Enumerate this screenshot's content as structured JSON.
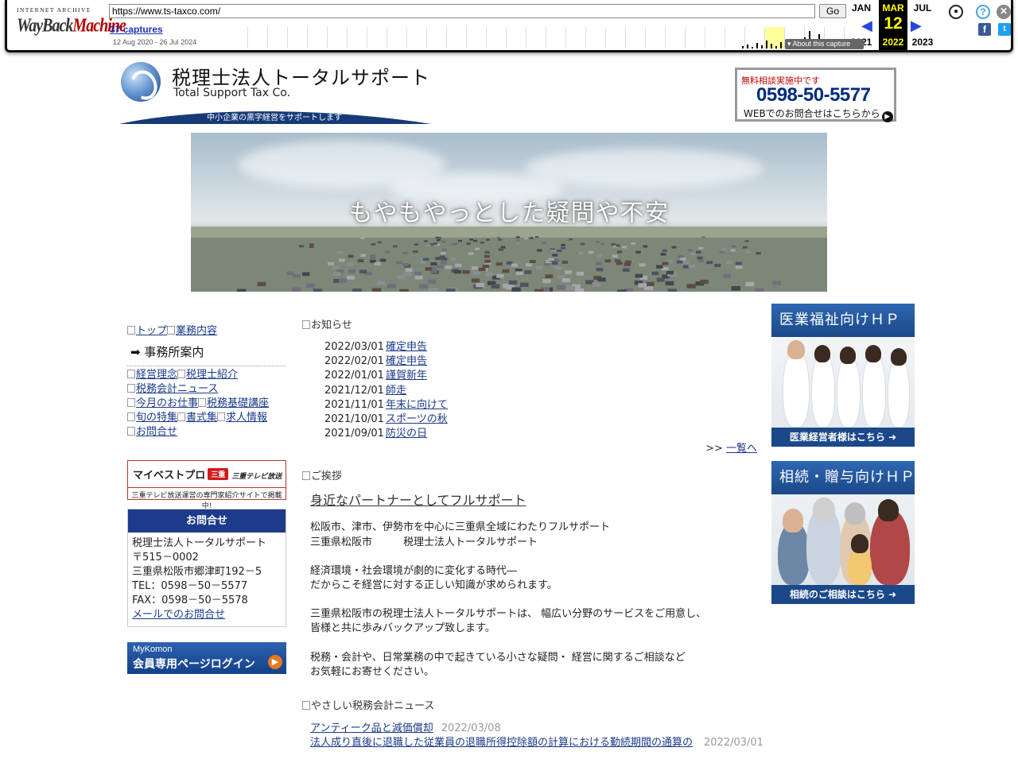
{
  "wayback": {
    "logo_top": "INTERNET ARCHIVE",
    "logo_main_a": "WayBack",
    "logo_main_b": "Machine",
    "url": "https://www.ts-taxco.com/",
    "go_label": "Go",
    "captures": "37 captures",
    "range": "12 Aug 2020 - 26 Jul 2024",
    "months": [
      {
        "month": "JAN",
        "year": "2021"
      },
      {
        "month": "MAR",
        "day": "12",
        "year": "2022"
      },
      {
        "month": "JUL",
        "year": "2023"
      }
    ],
    "about": "About this capture",
    "icons": [
      "user-icon",
      "help-icon",
      "close-icon",
      "facebook-icon",
      "twitter-icon"
    ]
  },
  "header": {
    "name": "税理士法人トータルサポート",
    "name_en": "Total Support Tax Co.",
    "tagline": "中小企業の黒字経営をサポートします",
    "contact_note": "無料相談実施中です",
    "phone": "0598-50-5577",
    "web_contact": "WEBでのお問合せはこちらから"
  },
  "hero": {
    "copy": "もやもやっとした疑問や不安"
  },
  "nav": {
    "row1": [
      "トップ",
      "業務内容"
    ],
    "current": "事務所案内",
    "row2": [
      "経営理念",
      "税理士紹介"
    ],
    "row3": [
      "税務会計ニュース"
    ],
    "row4": [
      "今月のお仕事",
      "税務基礎講座"
    ],
    "row5": [
      "旬の特集",
      "書式集",
      "求人情報"
    ],
    "row6": [
      "お問合せ"
    ]
  },
  "banner_mp": {
    "title": "マイベストプロ",
    "badge": "三重",
    "tv": "三重テレビ放送",
    "caption": "三重テレビ放送運営の専門家紹介サイトで掲載中!"
  },
  "contact": {
    "heading": "お問合せ",
    "lines": [
      "税理士法人トータルサポート",
      "〒515－0002",
      "三重県松阪市郷津町192－5",
      "TEL：0598－50－5577",
      "FAX：0598－50－5578"
    ],
    "mail_link": "メールでのお問合せ"
  },
  "mykomon": {
    "small": "MyKomon",
    "big": "会員専用ページログイン"
  },
  "news": {
    "heading": "お知らせ",
    "items": [
      {
        "date": "2022/03/01",
        "title": "確定申告"
      },
      {
        "date": "2022/02/01",
        "title": "確定申告"
      },
      {
        "date": "2022/01/01",
        "title": "謹賀新年"
      },
      {
        "date": "2021/12/01",
        "title": "師走"
      },
      {
        "date": "2021/11/01",
        "title": "年末に向けて"
      },
      {
        "date": "2021/10/01",
        "title": "スポーツの秋"
      },
      {
        "date": "2021/09/01",
        "title": "防災の日"
      }
    ],
    "more_prefix": ">> ",
    "more_link": "一覧へ"
  },
  "greeting": {
    "heading": "ご挨拶",
    "title": "身近なパートナーとしてフルサポート",
    "p1": "松阪市、津市、伊勢市を中心に三重県全域にわたりフルサポート\n三重県松阪市　　　税理士法人トータルサポート",
    "p2": "経済環境・社会環境が劇的に変化する時代―\nだからこそ経営に対する正しい知識が求められます。",
    "p3": "三重県松阪市の税理士法人トータルサポートは、 幅広い分野のサービスをご用意し、\n皆様と共に歩みバックアップ致します。",
    "p4": "税務・会計や、日常業務の中で起きている小さな疑問・ 経営に関するご相談など\nお気軽にお寄せください。"
  },
  "taxnews": {
    "heading": "やさしい税務会計ニュース",
    "items": [
      {
        "title": "アンティーク品と減価償却",
        "date": "2022/03/08"
      },
      {
        "title": "法人成り直後に退職した従業員の退職所得控除額の計算における勤続期間の通算の",
        "date": "2022/03/01"
      }
    ]
  },
  "side_banners": [
    {
      "title": "医業福祉向けＨＰ",
      "footer": "医業経営者様はこちら"
    },
    {
      "title": "相続・贈与向けＨＰ",
      "footer": "相続のご相談はこちら"
    }
  ]
}
